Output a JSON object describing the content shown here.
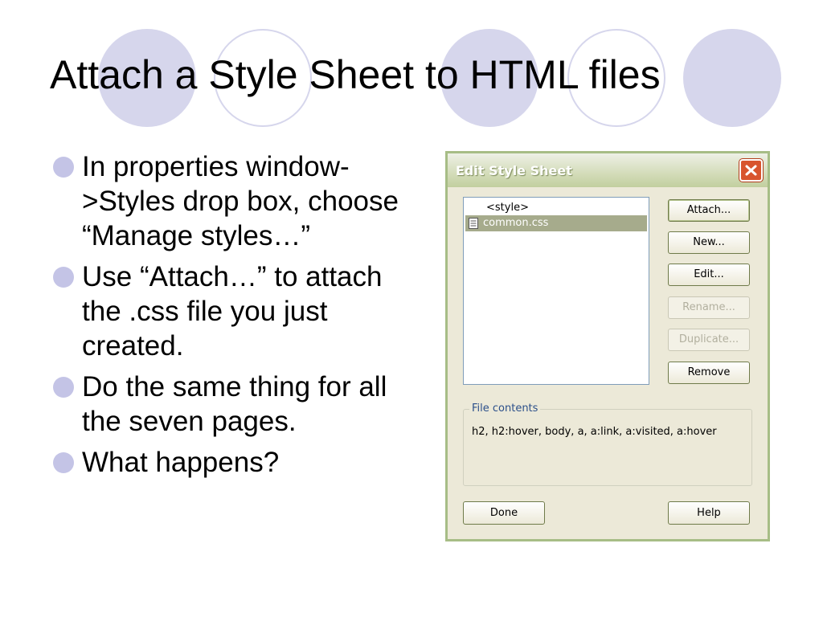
{
  "slide": {
    "title": "Attach a Style Sheet to HTML files",
    "bullets": [
      "In properties window->Styles drop box, choose “Manage styles…”",
      "Use “Attach…” to attach the .css file you just created.",
      "Do the same thing for all the seven pages.",
      "What happens?"
    ]
  },
  "dialog": {
    "title": "Edit Style Sheet",
    "list_items": [
      "<style>",
      "common.css"
    ],
    "buttons": {
      "attach": "Attach...",
      "new": "New...",
      "edit": "Edit...",
      "rename": "Rename...",
      "duplicate": "Duplicate...",
      "remove": "Remove"
    },
    "file_contents_label": "File contents",
    "file_contents": "h2, h2:hover, body, a, a:link, a:visited, a:hover",
    "done_label": "Done",
    "help_label": "Help"
  },
  "colors": {
    "circle": "#d6d6ec",
    "bullet": "#c4c4e6",
    "selection": "#a6ab8c",
    "close_button": "#d8552e"
  }
}
